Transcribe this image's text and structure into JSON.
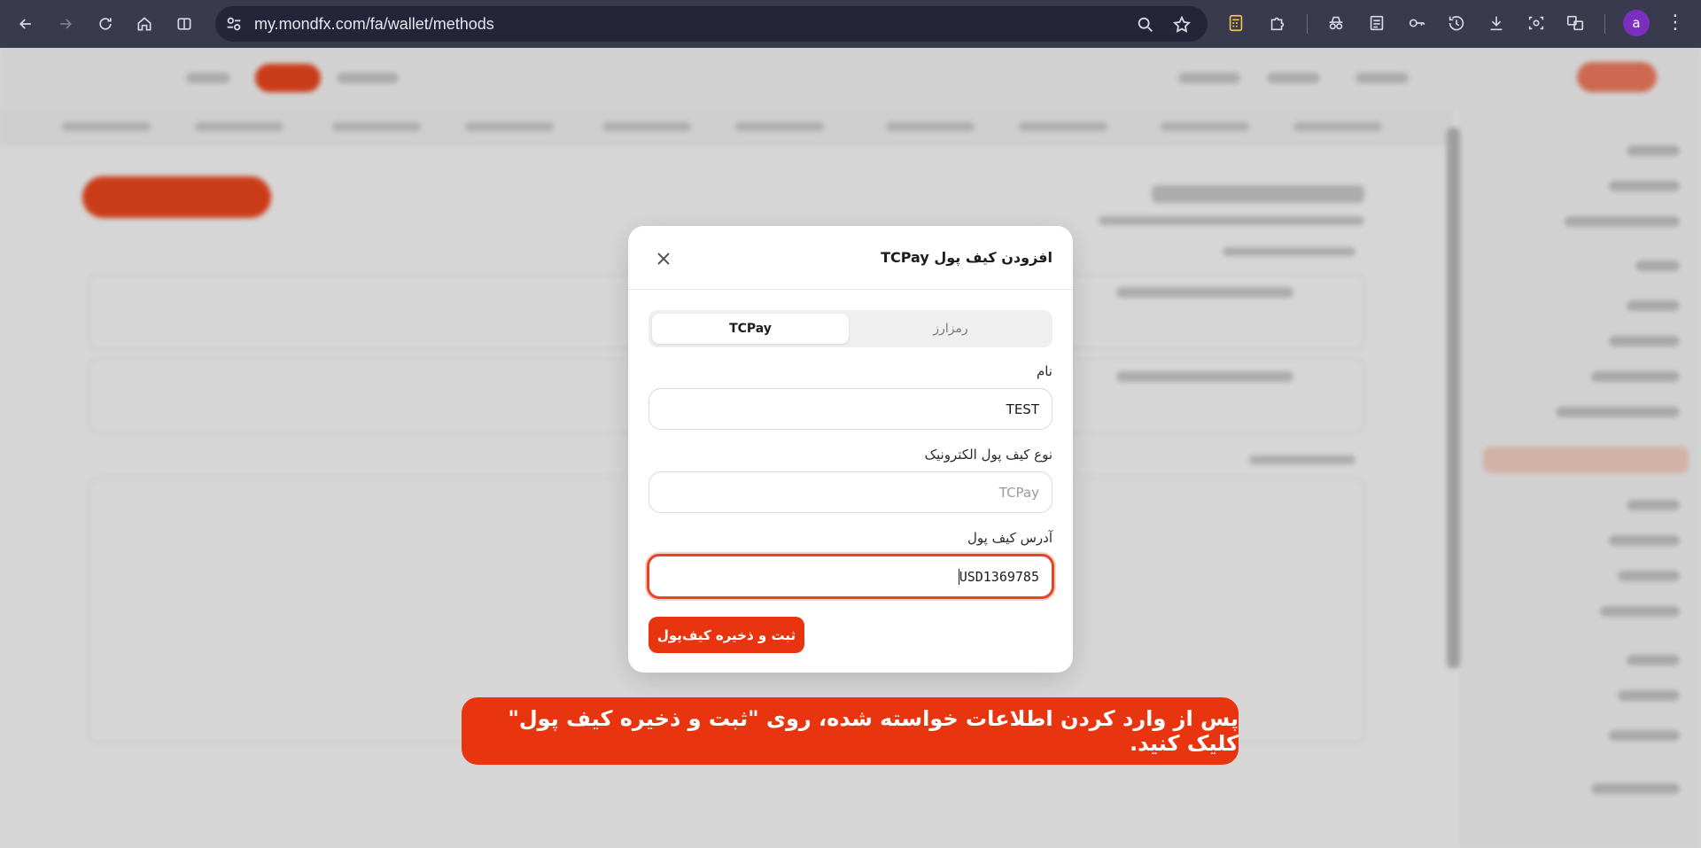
{
  "browser": {
    "url": "my.mondfx.com/fa/wallet/methods",
    "profile_initial": "a",
    "menu_glyph": "⋮"
  },
  "modal": {
    "title": "افزودن کیف پول TCPay",
    "tabs": [
      {
        "label": "رمزارز",
        "active": false
      },
      {
        "label": "TCPay",
        "active": true
      }
    ],
    "name": {
      "label": "نام",
      "value": "TEST"
    },
    "wallet_type": {
      "label": "نوع کیف پول الکترونیک",
      "value": "TCPay"
    },
    "wallet_address": {
      "label": "آدرس کیف پول",
      "value": "USD1369785"
    },
    "submit_label": "ثبت و ذخیره کیف‌پول"
  },
  "instruction_banner": {
    "text": "پس از وارد کردن اطلاعات خواسته شده، روی \"ثبت و ذخیره کیف پول\" کلیک کنید."
  },
  "colors": {
    "accent": "#e8350f",
    "browser_bar": "#3a3a4f",
    "avatar": "#7b2fbf"
  }
}
